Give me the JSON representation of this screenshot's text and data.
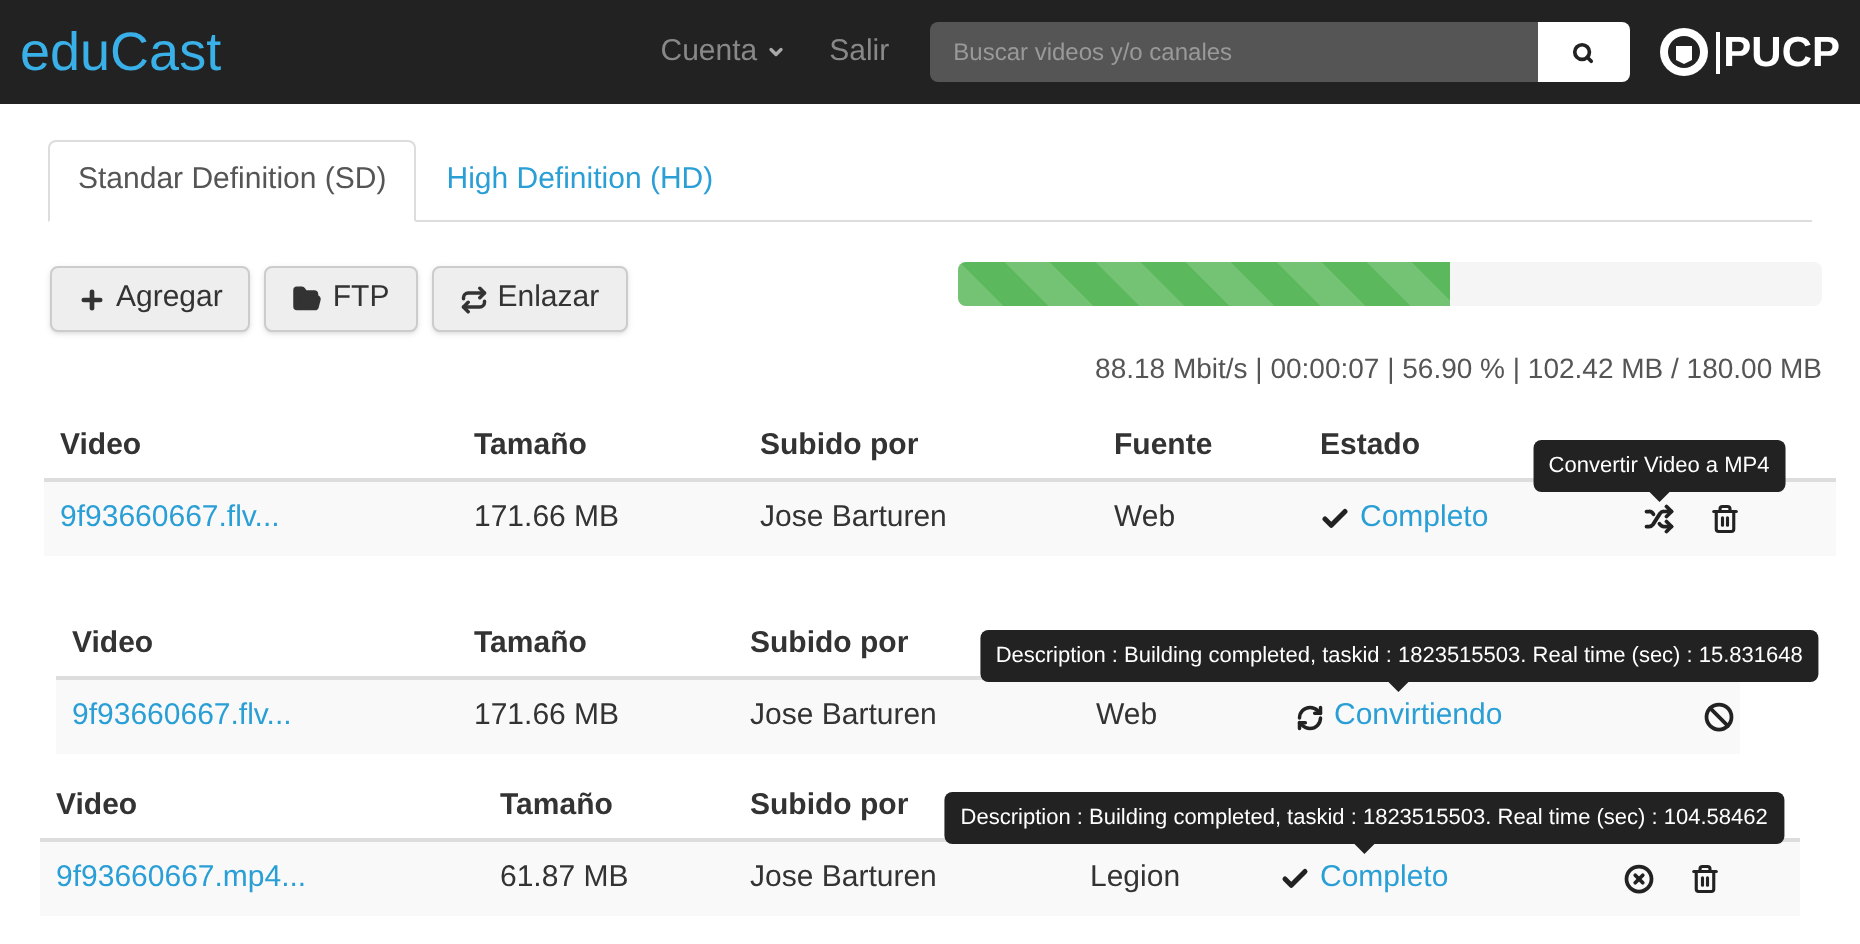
{
  "navbar": {
    "brand": "eduCast",
    "menu": [
      {
        "label": "Cuenta",
        "kind": "dropdown"
      },
      {
        "label": "Salir",
        "kind": "link"
      }
    ],
    "search": {
      "placeholder": "Buscar videos y/o canales"
    },
    "logo_text": "PUCP"
  },
  "tabs": [
    {
      "label": "Standar Definition (SD)",
      "selected": true
    },
    {
      "label": "High Definition (HD)",
      "selected": false
    }
  ],
  "toolbar": [
    {
      "label": "Agregar",
      "kind": "add"
    },
    {
      "label": "FTP",
      "kind": "ftp"
    },
    {
      "label": "Enlazar",
      "kind": "link"
    }
  ],
  "upload": {
    "level": 0.569,
    "stats": "88.18 Mbit/s | 00:00:07 | 56.90 % | 102.42 MB / 180.00 MB"
  },
  "tables": [
    {
      "columns": [
        "Video",
        "Tamaño",
        "Subido por",
        "Fuente",
        "Estado"
      ],
      "row": {
        "video": "9f93660667.flv...",
        "size": "171.66 MB",
        "uploader": "Jose Barturen",
        "source": "Web",
        "status": {
          "kind": "done",
          "label": "Completo"
        },
        "actions": [
          {
            "kind": "shuffle",
            "tooltip": "Convertir Video a MP4"
          },
          {
            "kind": "trash"
          }
        ]
      }
    },
    {
      "columns": [
        "Video",
        "Tamaño",
        "Subido por"
      ],
      "row": {
        "video": "9f93660667.flv...",
        "size": "171.66 MB",
        "uploader": "Jose Barturen",
        "source": "Web",
        "status": {
          "kind": "converting",
          "label": "Convirtiendo",
          "tooltip": "Description : Building completed, taskid : 1823515503. Real time (sec) : 15.831648"
        },
        "actions": [
          {
            "kind": "ban"
          }
        ]
      }
    },
    {
      "columns": [
        "Video",
        "Tamaño",
        "Subido por"
      ],
      "row": {
        "video": "9f93660667.mp4...",
        "size": "61.87 MB",
        "uploader": "Jose Barturen",
        "source": "Legion",
        "status": {
          "kind": "done",
          "label": "Completo",
          "tooltip": "Description : Building completed, taskid : 1823515503. Real time (sec) : 104.58462"
        },
        "actions": [
          {
            "kind": "remove"
          },
          {
            "kind": "trash"
          }
        ]
      }
    }
  ]
}
